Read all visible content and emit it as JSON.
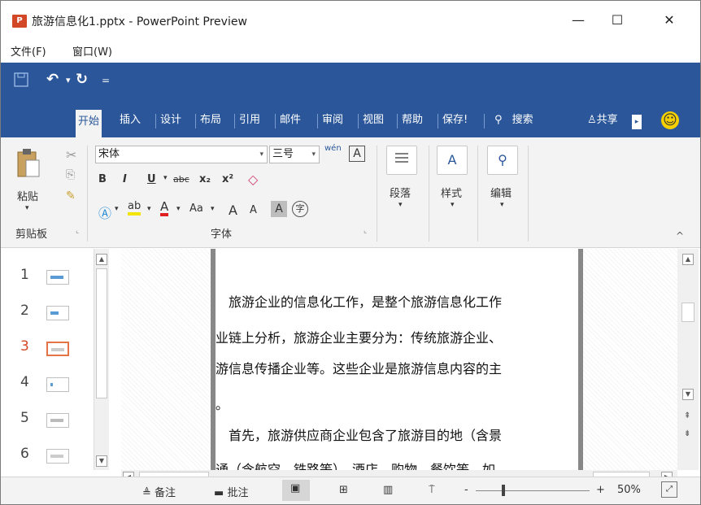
{
  "window": {
    "app_icon": "P",
    "title": "旅游信息化1.pptx - PowerPoint Preview",
    "minimize": "—",
    "maximize": "☐",
    "close": "✕"
  },
  "menu": {
    "file": "文件(F)",
    "window": "窗口(W)"
  },
  "qat": {
    "save_icon": "save-icon",
    "undo": "↶",
    "undo_dd": "▾",
    "redo": "↻",
    "customize": "="
  },
  "tabs": [
    "开始",
    "插入",
    "设计",
    "布局",
    "引用",
    "邮件",
    "审阅",
    "视图",
    "帮助",
    "保存!"
  ],
  "search": {
    "label": "搜索",
    "icon": "search-icon"
  },
  "share": {
    "label": "共享"
  },
  "emoji": "☺",
  "ribbon": {
    "paste": "粘贴",
    "clipboard_group": "剪贴板",
    "font_name": "宋体",
    "font_size": "三号",
    "font_group": "字体",
    "bold": "B",
    "italic": "I",
    "underline": "U",
    "strike": "abc",
    "sub": "x₂",
    "sup": "x²",
    "font_color": "A",
    "aa": "Aa",
    "grow": "A",
    "shrink": "A",
    "char_a": "A",
    "enclose": "字",
    "wen": "wén",
    "paragraph": "段落",
    "styles": "样式",
    "editing": "编辑",
    "collapse": "^"
  },
  "thumbnails": [
    {
      "num": "1",
      "active": false
    },
    {
      "num": "2",
      "active": false
    },
    {
      "num": "3",
      "active": true
    },
    {
      "num": "4",
      "active": false
    },
    {
      "num": "5",
      "active": false
    },
    {
      "num": "6",
      "active": false
    }
  ],
  "slide_text": [
    "　旅游企业的信息化工作，是整个旅游信息化工作",
    "业链上分析，旅游企业主要分为：传统旅游企业、",
    "游信息传播企业等。这些企业是旅游信息内容的主",
    "。",
    "　首先，旅游供应商企业包含了旅游目的地（含景",
    "通（含航空、铁路等）、酒店、购物、餐饮等。如"
  ],
  "status": {
    "notes": "备注",
    "comments": "批注",
    "zoom_minus": "-",
    "zoom_plus": "+",
    "zoom": "50%"
  }
}
